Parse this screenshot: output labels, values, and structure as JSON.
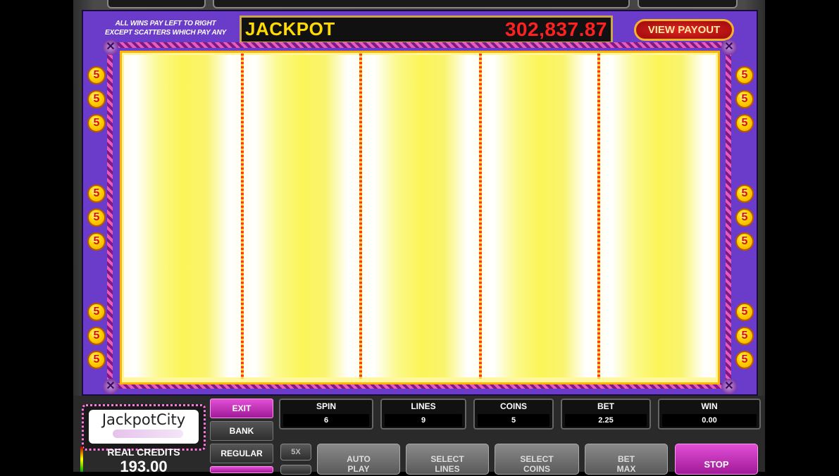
{
  "rules": {
    "line1": "ALL WINS PAY LEFT TO RIGHT",
    "line2": "EXCEPT SCATTERS WHICH PAY ANY"
  },
  "jackpot": {
    "label": "JACKPOT",
    "amount": "302,837.87"
  },
  "view_payout_label": "VIEW PAYOUT",
  "line_markers": {
    "label": "5",
    "count_per_side": 9
  },
  "logo": {
    "text": "JackpotCity"
  },
  "credits": {
    "label": "REAL CREDITS",
    "value": "193.00"
  },
  "side_buttons": {
    "exit": "EXIT",
    "bank": "BANK",
    "regular": "REGULAR"
  },
  "stats": {
    "spin": {
      "label": "SPIN",
      "value": "6"
    },
    "lines": {
      "label": "LINES",
      "value": "9"
    },
    "coins": {
      "label": "COINS",
      "value": "5"
    },
    "bet": {
      "label": "BET",
      "value": "2.25"
    },
    "win": {
      "label": "WIN",
      "value": "0.00"
    }
  },
  "controls": {
    "multiplier": "5X",
    "auto_play": [
      "AUTO",
      "PLAY"
    ],
    "select_lines": [
      "SELECT",
      "LINES"
    ],
    "select_coins": [
      "SELECT",
      "COINS"
    ],
    "bet_max": [
      "BET",
      "MAX"
    ],
    "stop": "STOP"
  },
  "colors": {
    "panel_purple": "#6a3cc9",
    "jackpot_gold": "#ffdb00",
    "jackpot_red": "#ff2020",
    "exit_magenta": "#c236b8"
  }
}
